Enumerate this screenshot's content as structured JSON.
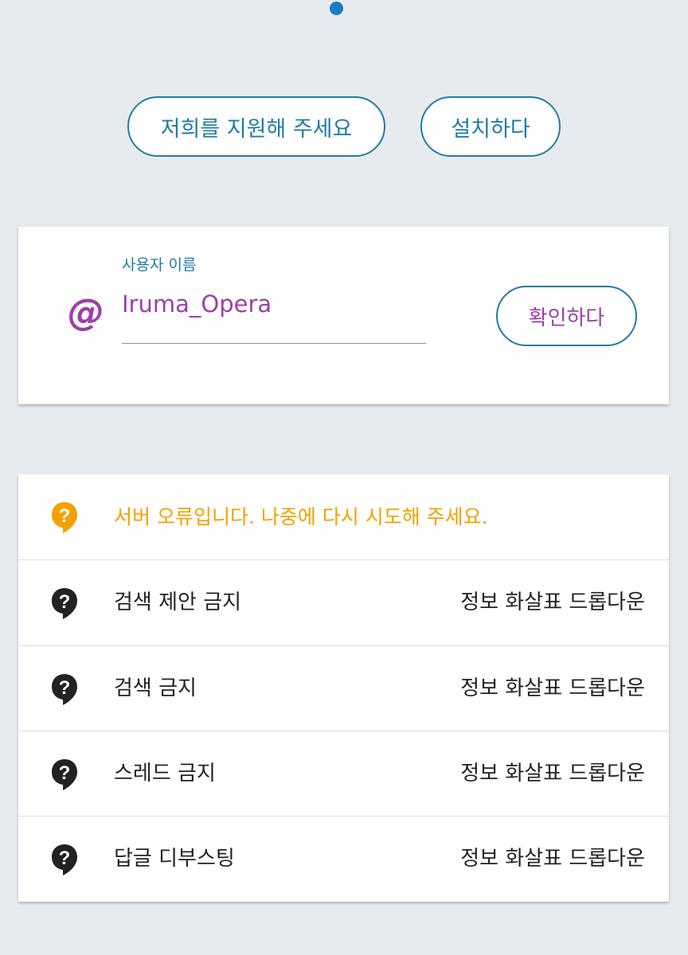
{
  "actions": {
    "support_label": "저희를 지원해 주세요",
    "install_label": "설치하다"
  },
  "user_form": {
    "field_label": "사용자 이름",
    "username_value": "Iruma_Opera",
    "at_symbol": "@",
    "confirm_label": "확인하다"
  },
  "settings": {
    "error_message": "서버 오류입니다. 나중에 다시 시도해 주세요.",
    "rows": [
      {
        "label": "검색 제안 금지",
        "value": "정보 화살표 드롭다운",
        "icon": "question-bubble-icon"
      },
      {
        "label": "검색 금지",
        "value": "정보 화살표 드롭다운",
        "icon": "question-bubble-icon"
      },
      {
        "label": "스레드 금지",
        "value": "정보 화살표 드롭다운",
        "icon": "question-bubble-icon"
      },
      {
        "label": "답글 디부스팅",
        "value": "정보 화살표 드롭다운",
        "icon": "question-bubble-icon"
      }
    ]
  },
  "colors": {
    "background": "#e6ebef",
    "accent_blue": "#1f7ca6",
    "accent_purple": "#9c3fa8",
    "warning": "#f2a100",
    "dot": "#1a7cc1"
  }
}
